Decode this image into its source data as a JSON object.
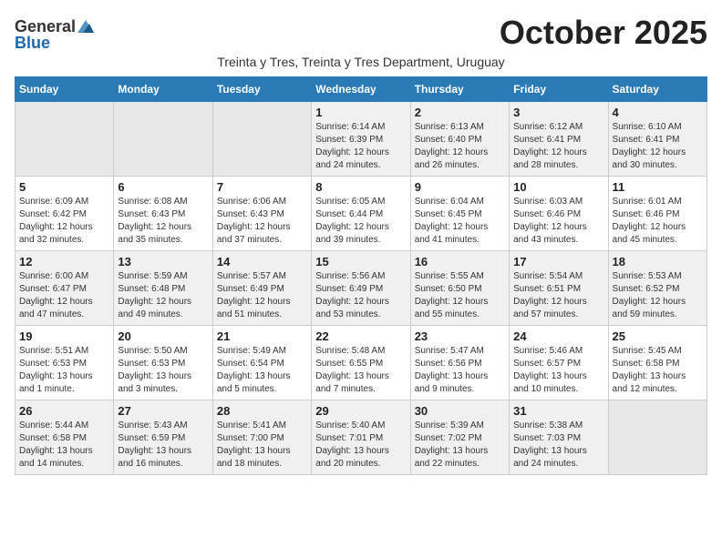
{
  "logo": {
    "general": "General",
    "blue": "Blue"
  },
  "title": "October 2025",
  "subtitle": "Treinta y Tres, Treinta y Tres Department, Uruguay",
  "days_of_week": [
    "Sunday",
    "Monday",
    "Tuesday",
    "Wednesday",
    "Thursday",
    "Friday",
    "Saturday"
  ],
  "weeks": [
    [
      {
        "day": "",
        "info": ""
      },
      {
        "day": "",
        "info": ""
      },
      {
        "day": "",
        "info": ""
      },
      {
        "day": "1",
        "info": "Sunrise: 6:14 AM\nSunset: 6:39 PM\nDaylight: 12 hours\nand 24 minutes."
      },
      {
        "day": "2",
        "info": "Sunrise: 6:13 AM\nSunset: 6:40 PM\nDaylight: 12 hours\nand 26 minutes."
      },
      {
        "day": "3",
        "info": "Sunrise: 6:12 AM\nSunset: 6:41 PM\nDaylight: 12 hours\nand 28 minutes."
      },
      {
        "day": "4",
        "info": "Sunrise: 6:10 AM\nSunset: 6:41 PM\nDaylight: 12 hours\nand 30 minutes."
      }
    ],
    [
      {
        "day": "5",
        "info": "Sunrise: 6:09 AM\nSunset: 6:42 PM\nDaylight: 12 hours\nand 32 minutes."
      },
      {
        "day": "6",
        "info": "Sunrise: 6:08 AM\nSunset: 6:43 PM\nDaylight: 12 hours\nand 35 minutes."
      },
      {
        "day": "7",
        "info": "Sunrise: 6:06 AM\nSunset: 6:43 PM\nDaylight: 12 hours\nand 37 minutes."
      },
      {
        "day": "8",
        "info": "Sunrise: 6:05 AM\nSunset: 6:44 PM\nDaylight: 12 hours\nand 39 minutes."
      },
      {
        "day": "9",
        "info": "Sunrise: 6:04 AM\nSunset: 6:45 PM\nDaylight: 12 hours\nand 41 minutes."
      },
      {
        "day": "10",
        "info": "Sunrise: 6:03 AM\nSunset: 6:46 PM\nDaylight: 12 hours\nand 43 minutes."
      },
      {
        "day": "11",
        "info": "Sunrise: 6:01 AM\nSunset: 6:46 PM\nDaylight: 12 hours\nand 45 minutes."
      }
    ],
    [
      {
        "day": "12",
        "info": "Sunrise: 6:00 AM\nSunset: 6:47 PM\nDaylight: 12 hours\nand 47 minutes."
      },
      {
        "day": "13",
        "info": "Sunrise: 5:59 AM\nSunset: 6:48 PM\nDaylight: 12 hours\nand 49 minutes."
      },
      {
        "day": "14",
        "info": "Sunrise: 5:57 AM\nSunset: 6:49 PM\nDaylight: 12 hours\nand 51 minutes."
      },
      {
        "day": "15",
        "info": "Sunrise: 5:56 AM\nSunset: 6:49 PM\nDaylight: 12 hours\nand 53 minutes."
      },
      {
        "day": "16",
        "info": "Sunrise: 5:55 AM\nSunset: 6:50 PM\nDaylight: 12 hours\nand 55 minutes."
      },
      {
        "day": "17",
        "info": "Sunrise: 5:54 AM\nSunset: 6:51 PM\nDaylight: 12 hours\nand 57 minutes."
      },
      {
        "day": "18",
        "info": "Sunrise: 5:53 AM\nSunset: 6:52 PM\nDaylight: 12 hours\nand 59 minutes."
      }
    ],
    [
      {
        "day": "19",
        "info": "Sunrise: 5:51 AM\nSunset: 6:53 PM\nDaylight: 13 hours\nand 1 minute."
      },
      {
        "day": "20",
        "info": "Sunrise: 5:50 AM\nSunset: 6:53 PM\nDaylight: 13 hours\nand 3 minutes."
      },
      {
        "day": "21",
        "info": "Sunrise: 5:49 AM\nSunset: 6:54 PM\nDaylight: 13 hours\nand 5 minutes."
      },
      {
        "day": "22",
        "info": "Sunrise: 5:48 AM\nSunset: 6:55 PM\nDaylight: 13 hours\nand 7 minutes."
      },
      {
        "day": "23",
        "info": "Sunrise: 5:47 AM\nSunset: 6:56 PM\nDaylight: 13 hours\nand 9 minutes."
      },
      {
        "day": "24",
        "info": "Sunrise: 5:46 AM\nSunset: 6:57 PM\nDaylight: 13 hours\nand 10 minutes."
      },
      {
        "day": "25",
        "info": "Sunrise: 5:45 AM\nSunset: 6:58 PM\nDaylight: 13 hours\nand 12 minutes."
      }
    ],
    [
      {
        "day": "26",
        "info": "Sunrise: 5:44 AM\nSunset: 6:58 PM\nDaylight: 13 hours\nand 14 minutes."
      },
      {
        "day": "27",
        "info": "Sunrise: 5:43 AM\nSunset: 6:59 PM\nDaylight: 13 hours\nand 16 minutes."
      },
      {
        "day": "28",
        "info": "Sunrise: 5:41 AM\nSunset: 7:00 PM\nDaylight: 13 hours\nand 18 minutes."
      },
      {
        "day": "29",
        "info": "Sunrise: 5:40 AM\nSunset: 7:01 PM\nDaylight: 13 hours\nand 20 minutes."
      },
      {
        "day": "30",
        "info": "Sunrise: 5:39 AM\nSunset: 7:02 PM\nDaylight: 13 hours\nand 22 minutes."
      },
      {
        "day": "31",
        "info": "Sunrise: 5:38 AM\nSunset: 7:03 PM\nDaylight: 13 hours\nand 24 minutes."
      },
      {
        "day": "",
        "info": ""
      }
    ]
  ]
}
